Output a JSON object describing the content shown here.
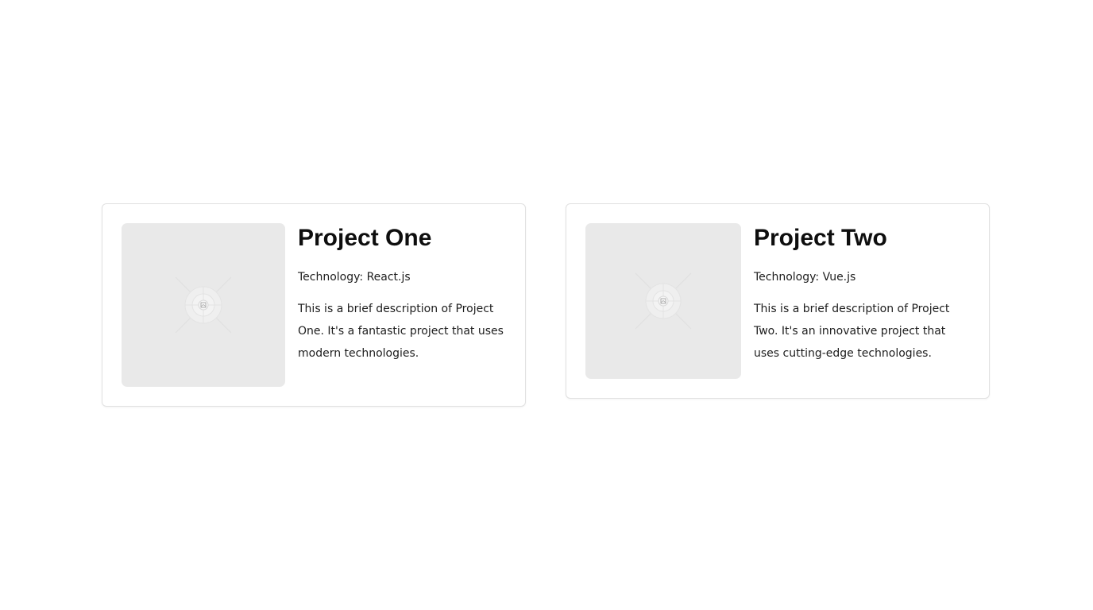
{
  "projects": [
    {
      "title": "Project One",
      "technology": "Technology: React.js",
      "description": "This is a brief description of Project One. It's a fantastic project that uses modern technologies.",
      "image_icon": "image-placeholder-icon"
    },
    {
      "title": "Project Two",
      "technology": "Technology: Vue.js",
      "description": "This is a brief description of Project Two. It's an innovative project that uses cutting-edge technologies.",
      "image_icon": "image-placeholder-icon"
    }
  ],
  "colors": {
    "card_border": "#e1e1e1",
    "thumb_background": "#e9e9e9",
    "title": "#0e0e0e",
    "text": "#1d1d1d"
  }
}
